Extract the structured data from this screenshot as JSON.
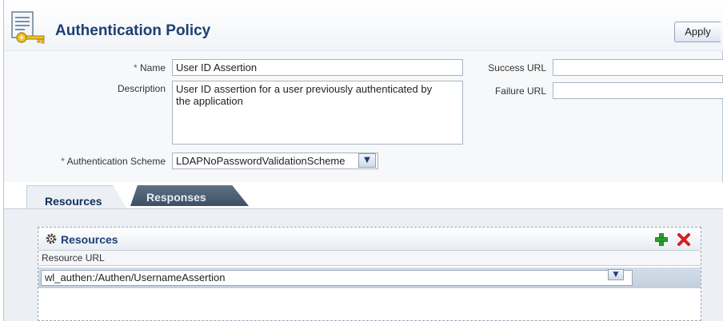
{
  "header": {
    "title": "Authentication Policy",
    "apply_label": "Apply"
  },
  "form": {
    "name": {
      "label": "Name",
      "required_mark": "*",
      "value": "User ID Assertion"
    },
    "description": {
      "label": "Description",
      "value": "User ID assertion for a user previously authenticated by the application"
    },
    "auth_scheme": {
      "label": "Authentication Scheme",
      "required_mark": "*",
      "value": "LDAPNoPasswordValidationScheme"
    },
    "success_url": {
      "label": "Success URL",
      "value": ""
    },
    "failure_url": {
      "label": "Failure URL",
      "value": ""
    }
  },
  "tabs": [
    {
      "label": "Resources",
      "active": true
    },
    {
      "label": "Responses",
      "active": false
    }
  ],
  "resources_panel": {
    "title": "Resources",
    "column_header": "Resource URL",
    "rows": [
      {
        "resource_url": "wl_authen:/Authen/UsernameAssertion"
      }
    ]
  },
  "icons": {
    "policy": "key-document-icon",
    "gear": "gear-icon",
    "add": "add-icon",
    "delete": "delete-icon",
    "dropdown": "chevron-down-icon"
  },
  "colors": {
    "title": "#1d3f73",
    "required": "#2a6bb8",
    "add": "#2e9b2e",
    "delete": "#d42020"
  }
}
